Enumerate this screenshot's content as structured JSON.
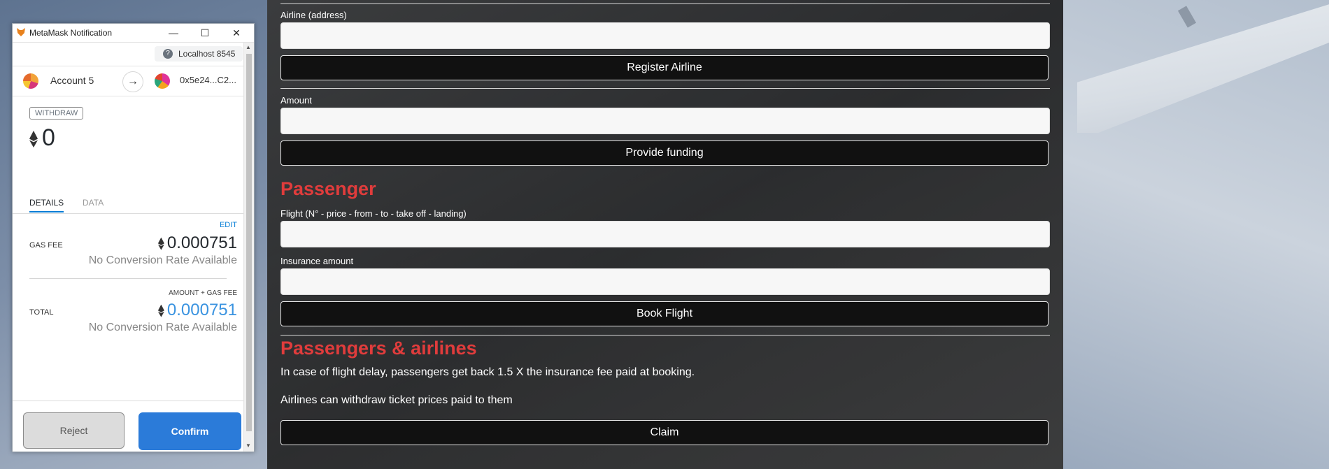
{
  "metamask": {
    "window_title": "MetaMask Notification",
    "network": "Localhost 8545",
    "from_account": "Account 5",
    "to_address": "0x5e24...C2...",
    "action_badge": "WITHDRAW",
    "amount": "0",
    "tabs": [
      {
        "label": "DETAILS"
      },
      {
        "label": "DATA"
      }
    ],
    "edit_label": "EDIT",
    "gas_fee_label": "GAS FEE",
    "gas_fee_value": "0.000751",
    "gas_fee_conversion": "No Conversion Rate Available",
    "amount_gas_label": "AMOUNT + GAS FEE",
    "total_label": "TOTAL",
    "total_value": "0.000751",
    "total_conversion": "No Conversion Rate Available",
    "reject_label": "Reject",
    "confirm_label": "Confirm"
  },
  "dapp": {
    "airline_address_label": "Airline (address)",
    "register_airline_button": "Register Airline",
    "amount_label": "Amount",
    "provide_funding_button": "Provide funding",
    "passenger_heading": "Passenger",
    "flight_label": "Flight (N° - price - from - to - take off - landing)",
    "insurance_label": "Insurance amount",
    "book_flight_button": "Book Flight",
    "passengers_airlines_heading": "Passengers & airlines",
    "delay_text": "In case of flight delay, passengers get back 1.5 X the insurance fee paid at booking.",
    "withdraw_text": "Airlines can withdraw ticket prices paid to them",
    "claim_button": "Claim"
  },
  "colors": {
    "heading_red": "#e03c3c",
    "confirm_blue": "#2b7bd9",
    "link_blue": "#037dd6"
  }
}
